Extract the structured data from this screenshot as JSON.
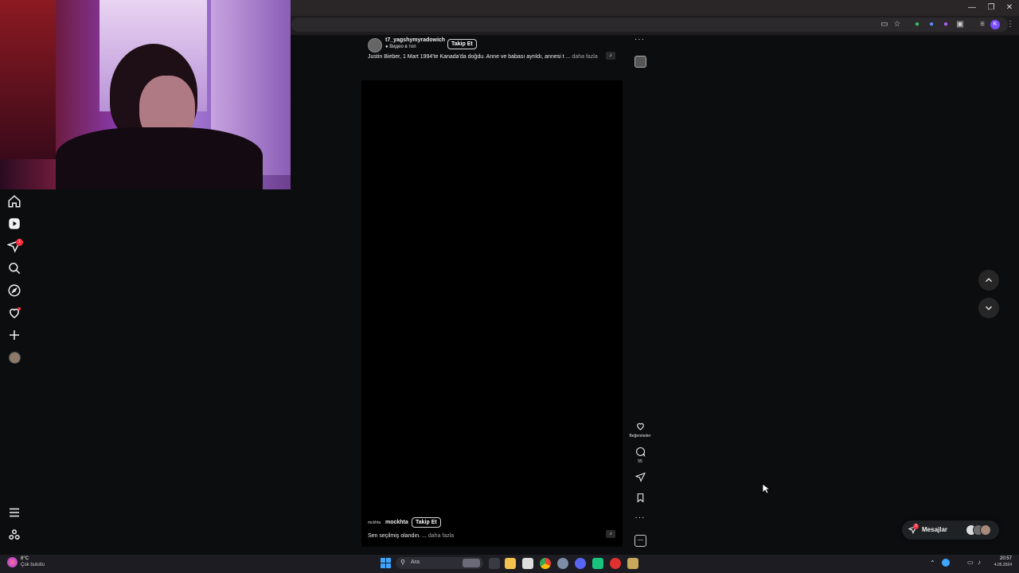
{
  "post_top": {
    "username": "t7_yagshymyradowich",
    "location": "Видео в топ",
    "follow_label": "Takip Et",
    "caption": "Justin Bieber, 1 Mart 1994'te Kanada'da doğdu. Anne ve babası ayrıldı, annesi t ...",
    "more_label": "daha fazla"
  },
  "post_main": {
    "avatar_label": "mckhta",
    "username": "mockhta",
    "follow_label": "Takip Et",
    "caption": "Sen seçilmiş olandın. ...",
    "more_label": "daha fazla"
  },
  "actions": {
    "likes_label": "Beğenmeler",
    "comments_count": "55"
  },
  "messages": {
    "label": "Mesajlar",
    "badge": "3"
  },
  "notifications_badge": "1",
  "weather": {
    "temp": "8°C",
    "condition": "Çok bulutlu"
  },
  "taskbar": {
    "search_placeholder": "Ara",
    "time": "20:57",
    "date": "4.05.2024"
  },
  "colors": {
    "background": "#0b0d0f",
    "badge_red": "#ff3040",
    "text": "#f1f1f1"
  }
}
